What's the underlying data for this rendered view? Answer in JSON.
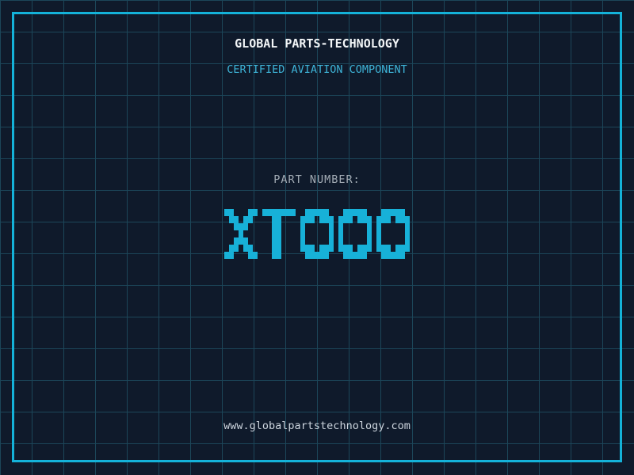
{
  "header": {
    "title": "GLOBAL PARTS-TECHNOLOGY",
    "subtitle": "CERTIFIED AVIATION COMPONENT"
  },
  "part": {
    "label": "PART NUMBER:",
    "number": "XT000"
  },
  "footer": {
    "url": "www.globalpartstechnology.com"
  },
  "colors": {
    "background": "#0f1a2b",
    "grid_line": "#1c4659",
    "frame": "#14b2d9",
    "title_text": "#f2f5f7",
    "subtitle_text": "#3eb4d8",
    "part_label_text": "#a4adb6",
    "part_number_text": "#17b1d8",
    "footer_text": "#ccd4dd"
  }
}
